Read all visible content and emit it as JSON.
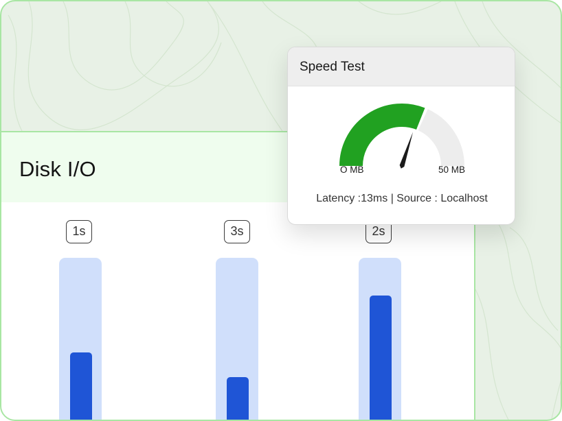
{
  "disk_io": {
    "title": "Disk I/O",
    "bars": [
      {
        "label": "1s",
        "fill": 0.47
      },
      {
        "label": "3s",
        "fill": 0.33
      },
      {
        "label": "2s",
        "fill": 0.79
      }
    ]
  },
  "speed_test": {
    "title": "Speed Test",
    "gauge_min": "O MB",
    "gauge_max": "50 MB",
    "gauge_value": 0.62,
    "info": "Latency :13ms | Source : Localhost"
  },
  "colors": {
    "frame_border": "#a8e6a3",
    "background": "#e8f1e6",
    "header_bg": "#effdee",
    "bar_track": "#d0dffb",
    "bar_fill": "#1f55d6",
    "gauge_fill": "#21a121",
    "gauge_track": "#ededed"
  }
}
